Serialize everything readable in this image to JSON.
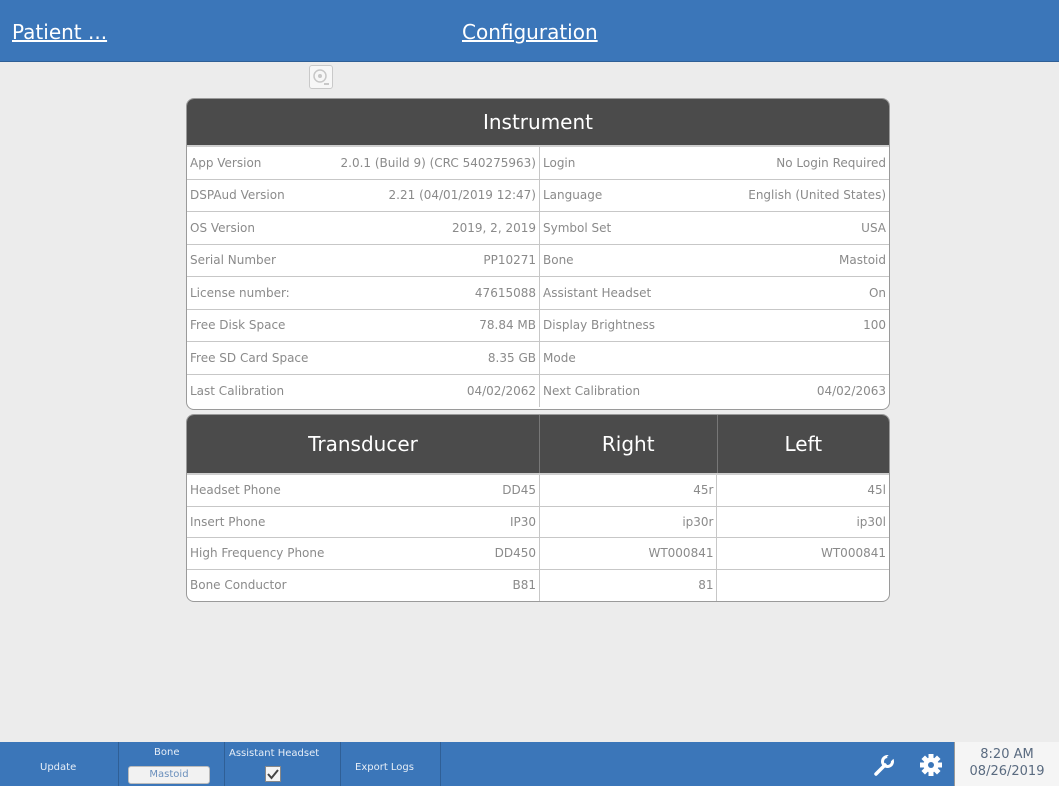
{
  "header": {
    "patient_link": "Patient ...",
    "title": "Configuration"
  },
  "instrument": {
    "title": "Instrument",
    "left": [
      {
        "label": "App Version",
        "value": "2.0.1 (Build 9) (CRC 540275963)"
      },
      {
        "label": "DSPAud Version",
        "value": "2.21 (04/01/2019 12:47)"
      },
      {
        "label": "OS Version",
        "value": "2019, 2, 2019"
      },
      {
        "label": "Serial Number",
        "value": "PP10271"
      },
      {
        "label": "License number:",
        "value": "47615088"
      },
      {
        "label": "Free Disk Space",
        "value": "78.84 MB"
      },
      {
        "label": "Free SD Card Space",
        "value": "8.35 GB"
      },
      {
        "label": "Last Calibration",
        "value": "04/02/2062"
      }
    ],
    "right": [
      {
        "label": "Login",
        "value": "No Login Required"
      },
      {
        "label": "Language",
        "value": "English (United States)"
      },
      {
        "label": "Symbol Set",
        "value": "USA"
      },
      {
        "label": "Bone",
        "value": "Mastoid"
      },
      {
        "label": "Assistant Headset",
        "value": "On"
      },
      {
        "label": "Display Brightness",
        "value": "100"
      },
      {
        "label": "Mode",
        "value": ""
      },
      {
        "label": "Next Calibration",
        "value": "04/02/2063"
      }
    ]
  },
  "transducer": {
    "headers": {
      "name": "Transducer",
      "right": "Right",
      "left": "Left"
    },
    "rows": [
      {
        "name": "Headset Phone",
        "model": "DD45",
        "right": "45r",
        "left": "45l"
      },
      {
        "name": "Insert Phone",
        "model": "IP30",
        "right": "ip30r",
        "left": "ip30l"
      },
      {
        "name": "High Frequency Phone",
        "model": "DD450",
        "right": "WT000841",
        "left": "WT000841"
      },
      {
        "name": "Bone Conductor",
        "model": "B81",
        "right": "81",
        "left": ""
      }
    ]
  },
  "bottom": {
    "update": "Update",
    "bone_label": "Bone",
    "bone_value": "Mastoid",
    "assistant_headset": "Assistant Headset",
    "assistant_checked": true,
    "export_logs": "Export Logs",
    "time": "8:20 AM",
    "date": "08/26/2019"
  },
  "icons": {
    "wrench": "wrench-icon",
    "gear": "gear-icon",
    "top": "device-icon"
  },
  "colors": {
    "bar": "#3b76b9",
    "panel_header": "#4b4b4b"
  }
}
